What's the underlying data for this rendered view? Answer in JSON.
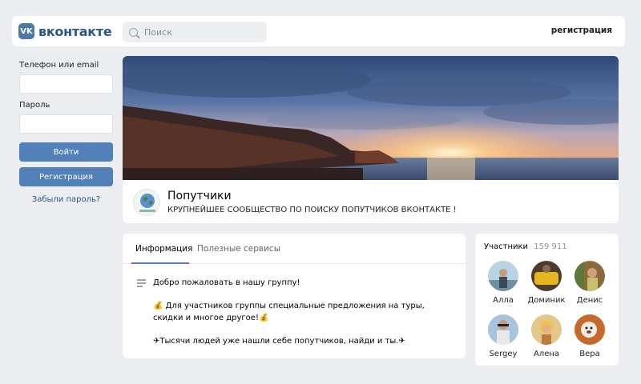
{
  "header": {
    "logo_mark": "VK",
    "logo_text": "вконтакте",
    "search_placeholder": "Поиск",
    "register_link": "регистрация"
  },
  "login": {
    "phone_label": "Телефон или email",
    "password_label": "Пароль",
    "login_button": "Войти",
    "register_button": "Регистрация",
    "forgot_link": "Забыли пароль?"
  },
  "group": {
    "name": "Попутчики",
    "status": "КРУПНЕЙШЕЕ СООБЩЕСТВО ПО ПОИСКУ ПОПУТЧИКОВ ВКОНТАКТЕ !"
  },
  "info": {
    "tabs": [
      "Информация",
      "Полезные сервисы"
    ],
    "paragraphs": [
      "Добро пожаловать в нашу группу!",
      "💰 Для участников группы специальные предложения на туры, скидки и многое другое!💰",
      "✈Тысячи людей уже нашли себе попутчиков, найди и ты.✈"
    ]
  },
  "members": {
    "title": "Участники",
    "count": "159 911",
    "people": [
      {
        "name": "Алла"
      },
      {
        "name": "Доминик"
      },
      {
        "name": "Денис"
      },
      {
        "name": "Sergey"
      },
      {
        "name": "Алена"
      },
      {
        "name": "Вера"
      }
    ]
  },
  "colors": {
    "accent": "#5181b8",
    "link": "#2a5885",
    "background": "#ebedf0"
  }
}
